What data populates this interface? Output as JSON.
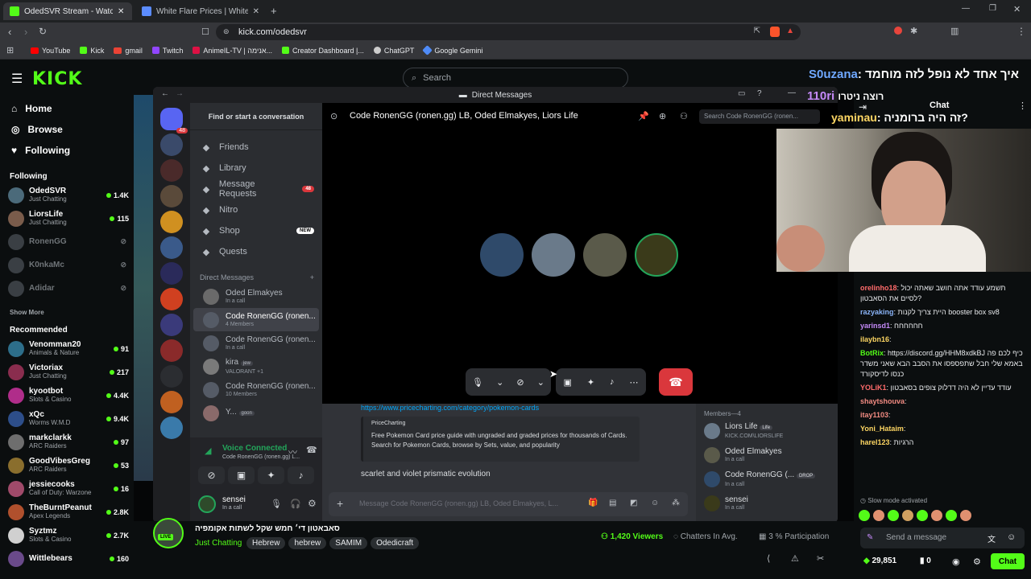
{
  "browser": {
    "tabs": [
      {
        "title": "OdedSVR Stream - Watch Live o"
      },
      {
        "title": "White Flare Prices | White Flare List"
      }
    ],
    "url": "kick.com/odedsvr",
    "bookmarks": [
      "YouTube",
      "Kick",
      "gmail",
      "Twitch",
      "AnimeIL-TV | אנימה...",
      "Creator Dashboard |...",
      "ChatGPT",
      "Google Gemini"
    ]
  },
  "kick": {
    "logo": "KICK",
    "search_placeholder": "Search",
    "nav": [
      {
        "label": "Home",
        "icon": "home-icon"
      },
      {
        "label": "Browse",
        "icon": "compass-icon"
      },
      {
        "label": "Following",
        "icon": "heart-icon"
      }
    ],
    "following_header": "Following",
    "following": [
      {
        "name": "OdedSVR",
        "category": "Just Chatting",
        "viewers": "1.4K",
        "live": true,
        "color": "#4b6a7a"
      },
      {
        "name": "LiorsLife",
        "category": "Just Chatting",
        "viewers": "115",
        "live": true,
        "color": "#7a5c4b"
      },
      {
        "name": "RonenGG",
        "category": "",
        "viewers": "",
        "live": false,
        "color": "#3a3f44"
      },
      {
        "name": "K0nkaMc",
        "category": "",
        "viewers": "",
        "live": false,
        "color": "#3a3f44"
      },
      {
        "name": "Adidar",
        "category": "",
        "viewers": "",
        "live": false,
        "color": "#3a3f44"
      }
    ],
    "show_more": "Show More",
    "recommended_header": "Recommended",
    "recommended": [
      {
        "name": "Venomman20",
        "category": "Animals & Nature",
        "viewers": "91",
        "color": "#2d6e8a"
      },
      {
        "name": "Victoriax",
        "category": "Just Chatting",
        "viewers": "217",
        "color": "#8a2d4e"
      },
      {
        "name": "kyootbot",
        "category": "Slots & Casino",
        "viewers": "4.4K",
        "color": "#b02d8a"
      },
      {
        "name": "xQc",
        "category": "Worms W.M.D",
        "viewers": "9.4K",
        "color": "#2d4e8a"
      },
      {
        "name": "markclarkk",
        "category": "ARC Raiders",
        "viewers": "97",
        "color": "#6e6e6e"
      },
      {
        "name": "GoodVibesGreg",
        "category": "ARC Raiders",
        "viewers": "53",
        "color": "#8a6e2d"
      },
      {
        "name": "jessiecooks",
        "category": "Call of Duty: Warzone",
        "viewers": "16",
        "color": "#a04a6a"
      },
      {
        "name": "TheBurntPeanut",
        "category": "Apex Legends",
        "viewers": "2.8K",
        "color": "#b0502d"
      },
      {
        "name": "Syztmz",
        "category": "Slots & Casino",
        "viewers": "2.7K",
        "color": "#d0d0d0"
      },
      {
        "name": "Wittlebears",
        "category": "",
        "viewers": "160",
        "color": "#6a4a8a"
      }
    ],
    "stream_title": "סאבאטון די׳ חמש שקל לשתות אקומפיה",
    "stream_category": "Just Chatting",
    "stream_tags": [
      "Hebrew",
      "hebrew",
      "SAMIM",
      "Odedicraft"
    ],
    "viewers_label": "1,420 Viewers",
    "chatters_label": "Chatters In Avg.",
    "participation_label": "3 % Participation"
  },
  "discord": {
    "window_title": "Direct Messages",
    "find_placeholder": "Find or start a conversation",
    "rail_badge": "48",
    "nav": [
      {
        "label": "Friends",
        "icon": "friends-icon"
      },
      {
        "label": "Library",
        "icon": "library-icon"
      },
      {
        "label": "Message Requests",
        "icon": "envelope-icon",
        "badge": "48"
      },
      {
        "label": "Nitro",
        "icon": "nitro-icon"
      },
      {
        "label": "Shop",
        "icon": "shop-icon",
        "badge": "NEW"
      },
      {
        "label": "Quests",
        "icon": "quests-icon"
      }
    ],
    "dm_header": "Direct Messages",
    "dms": [
      {
        "name": "Oded Elmakyes",
        "status": "In a call",
        "color": "#6a6a6a"
      },
      {
        "name": "Code RonenGG (ronen...",
        "status": "4 Members",
        "color": "#555b66",
        "selected": true
      },
      {
        "name": "Code RonenGG (ronen...",
        "status": "In a call",
        "color": "#555b66"
      },
      {
        "name": "kira",
        "status": "VALORANT +1",
        "badge": "jew",
        "color": "#7a7a7a"
      },
      {
        "name": "Code RonenGG (ronen...",
        "status": "10 Members",
        "color": "#555b66"
      },
      {
        "name": "Y...",
        "status": "",
        "badge": "goon",
        "color": "#8a6a6a"
      }
    ],
    "voice": {
      "label": "Voice Connected",
      "channel": "Code RonenGG (ronen.gg) L..."
    },
    "user": {
      "name": "sensei",
      "status": "In a call"
    },
    "call": {
      "header": "Code RonenGG (ronen.gg) LB, Oded Elmakyes, Liors Life",
      "search_placeholder": "Search Code RonenGG (ronen...",
      "participants": [
        {
          "name": "RonenGG",
          "color": "#2f4a6a"
        },
        {
          "name": "Liors Life",
          "color": "#6a7a8a"
        },
        {
          "name": "Oded Elmakyes",
          "color": "#5a5a4a"
        },
        {
          "name": "sensei",
          "color": "#3a3a1a"
        }
      ]
    },
    "chat": {
      "link": "https://www.pricecharting.com/category/pokemon-cards",
      "embed_site": "PriceCharting",
      "embed_text": "Free Pokemon Card price guide with ungraded and graded prices for thousands of Cards. Search for Pokemon Cards, browse by Sets, value, and popularity",
      "message": "scarlet and violet prismatic evolution",
      "input_placeholder": "Message Code RonenGG (ronen.gg) LB, Oded Elmakyes, L..."
    },
    "members_header": "Members—4",
    "members": [
      {
        "name": "Liors Life",
        "sub": "KICK.COM\\LIORSLIFE",
        "badge": "Life",
        "color": "#6a7a8a"
      },
      {
        "name": "Oded Elmakyes",
        "sub": "In a call",
        "badge": "",
        "color": "#5a5a4a"
      },
      {
        "name": "Code RonenGG (...",
        "sub": "In a call",
        "badge": "DROP",
        "color": "#2f4a6a"
      },
      {
        "name": "sensei",
        "sub": "In a call",
        "badge": "",
        "color": "#3a3a1a"
      }
    ]
  },
  "chat": {
    "header": "Chat",
    "overlay_lines": [
      {
        "user": "S0uzana",
        "text": ": איך אחד לא נופל לזה מוחמד"
      },
      {
        "user": "110ri",
        "text": "רוצה ניטרו"
      },
      {
        "user": "yaminau",
        "text": ": זה היה ברומניה?"
      }
    ],
    "messages": [
      {
        "user": "orelinho18",
        "text": ": תשמע עודד אתה חושב שאתה יכול לסיים את הסאבטון?",
        "color": "#ff6b6b"
      },
      {
        "user": "razyaking",
        "text": ": היית צריך לקנות booster box sv8",
        "color": "#8ab4f8"
      },
      {
        "user": "yarinsd1",
        "text": ": חחחחחח",
        "color": "#c58af9"
      },
      {
        "user": "ilaybn16",
        "text": ":",
        "color": "#fdd663"
      },
      {
        "user": "BotRix",
        "text": ": https://discord.gg/HHM8xdkBJ כיף לכם פה באמא שלי חבל שתפספסו את הסבב הבא שאני משדר כנסו לדיסקורד",
        "color": "#53fc18"
      },
      {
        "user": "YOLiK1",
        "text": ": עודד עדיין לא היה דדלוק צופים בסאבטון",
        "color": "#ff6b6b"
      },
      {
        "user": "shaytshouva",
        "text": ":",
        "color": "#f28b82"
      },
      {
        "user": "itay1103",
        "text": ":",
        "color": "#f28b82"
      },
      {
        "user": "Yoni_Hataim",
        "text": ":",
        "color": "#fdd663"
      },
      {
        "user": "harel123",
        "text": ": הרגיות",
        "color": "#fdd663"
      }
    ],
    "slow_mode": "Slow mode activated",
    "input_placeholder": "Send a message",
    "points": "29,851",
    "count": "0",
    "chat_button": "Chat"
  },
  "colors": {
    "kick_green": "#53fc18",
    "discord_blurple": "#5865f2",
    "hangup_red": "#da373c"
  }
}
